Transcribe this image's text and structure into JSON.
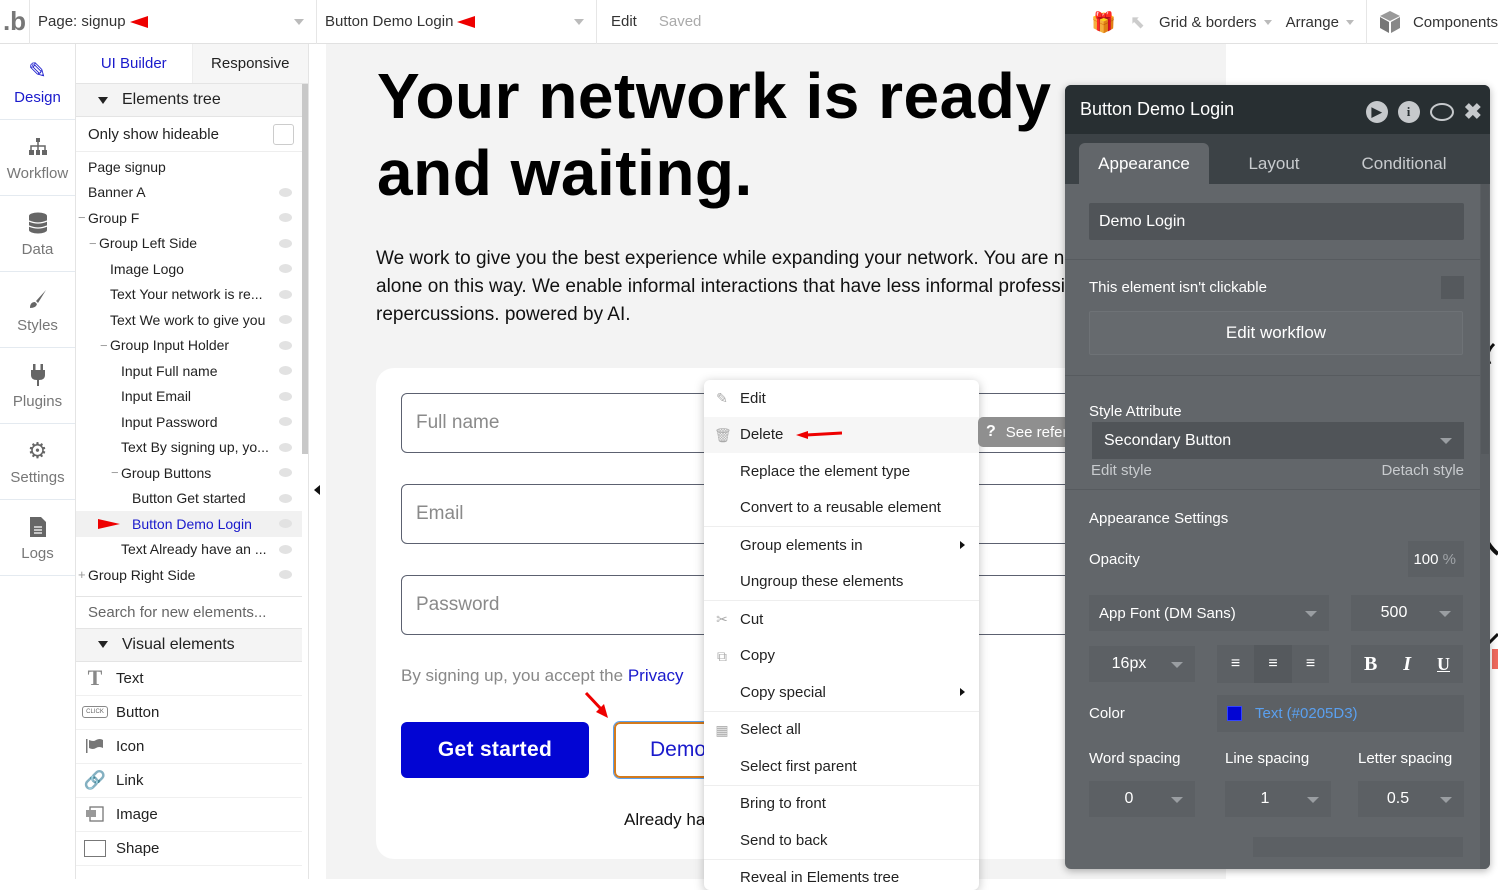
{
  "topbar": {
    "logo": ".b",
    "page_selector": "Page: signup",
    "element_selector": "Button Demo Login",
    "edit": "Edit",
    "saved": "Saved",
    "grid_borders": "Grid & borders",
    "arrange": "Arrange",
    "components": "Components"
  },
  "leftnav": [
    {
      "label": "Design",
      "icon": "design-icon",
      "active": true
    },
    {
      "label": "Workflow",
      "icon": "workflow-icon"
    },
    {
      "label": "Data",
      "icon": "database-icon"
    },
    {
      "label": "Styles",
      "icon": "brush-icon"
    },
    {
      "label": "Plugins",
      "icon": "plug-icon"
    },
    {
      "label": "Settings",
      "icon": "gear-icon"
    },
    {
      "label": "Logs",
      "icon": "document-icon"
    }
  ],
  "panel": {
    "tabs": [
      "UI Builder",
      "Responsive"
    ],
    "elements_tree_title": "Elements tree",
    "only_show_hideable": "Only show hideable",
    "tree": [
      {
        "label": "Page signup",
        "depth": 0,
        "toggle": "",
        "eye": false
      },
      {
        "label": "Banner A",
        "depth": 0,
        "toggle": "",
        "eye": true
      },
      {
        "label": "Group F",
        "depth": 0,
        "toggle": "−",
        "eye": true
      },
      {
        "label": "Group Left Side",
        "depth": 1,
        "toggle": "−",
        "eye": true
      },
      {
        "label": "Image Logo",
        "depth": 2,
        "toggle": "",
        "eye": true
      },
      {
        "label": "Text Your network is re...",
        "depth": 2,
        "toggle": "",
        "eye": true
      },
      {
        "label": "Text We work to give you",
        "depth": 2,
        "toggle": "",
        "eye": true
      },
      {
        "label": "Group Input Holder",
        "depth": 2,
        "toggle": "−",
        "eye": true
      },
      {
        "label": "Input Full name",
        "depth": 3,
        "toggle": "",
        "eye": true
      },
      {
        "label": "Input Email",
        "depth": 3,
        "toggle": "",
        "eye": true
      },
      {
        "label": "Input Password",
        "depth": 3,
        "toggle": "",
        "eye": true
      },
      {
        "label": "Text By signing up, yo...",
        "depth": 3,
        "toggle": "",
        "eye": true
      },
      {
        "label": "Group Buttons",
        "depth": 3,
        "toggle": "−",
        "eye": true
      },
      {
        "label": "Button Get started",
        "depth": 4,
        "toggle": "",
        "eye": true
      },
      {
        "label": "Button Demo Login",
        "depth": 4,
        "toggle": "",
        "eye": true,
        "selected": true
      },
      {
        "label": "Text Already have an ...",
        "depth": 3,
        "toggle": "",
        "eye": true
      },
      {
        "label": "Group Right Side",
        "depth": 0,
        "toggle": "+",
        "eye": true
      }
    ],
    "search_placeholder": "Search for new elements...",
    "visual_elements_title": "Visual elements",
    "visual_elements": [
      {
        "label": "Text",
        "icon": "text-icon"
      },
      {
        "label": "Button",
        "icon": "button-icon",
        "badge": "CLICK"
      },
      {
        "label": "Icon",
        "icon": "flag-icon"
      },
      {
        "label": "Link",
        "icon": "link-icon"
      },
      {
        "label": "Image",
        "icon": "image-icon"
      },
      {
        "label": "Shape",
        "icon": "shape-icon"
      }
    ]
  },
  "canvas": {
    "headline_line1": "Your network is ready",
    "headline_line2": "and waiting.",
    "para_line1": "We work to give you the best experience while expanding your network. You are not",
    "para_line2": "alone on this way. We enable informal interactions that have less informal professional",
    "para_line3": "repercussions. powered by AI.",
    "inputs": [
      {
        "placeholder": "Full name"
      },
      {
        "placeholder": "Email"
      },
      {
        "placeholder": "Password"
      }
    ],
    "terms_prefix": "By signing up, you accept the ",
    "terms_link": "Privacy",
    "btn_get_started": "Get started",
    "btn_demo": "Demo Login",
    "already": "Already have an account?"
  },
  "context_menu": {
    "items": [
      {
        "label": "Edit",
        "icon": "edit-icon",
        "group": 1
      },
      {
        "label": "Delete",
        "icon": "trash-icon",
        "group": 1,
        "hover": true
      },
      {
        "label": "Replace the element type",
        "group": 1
      },
      {
        "label": "Convert to a reusable element",
        "group": 1
      },
      {
        "label": "Group elements in",
        "group": 2,
        "submenu": true
      },
      {
        "label": "Ungroup these elements",
        "group": 2
      },
      {
        "label": "Cut",
        "icon": "scissors-icon",
        "group": 3
      },
      {
        "label": "Copy",
        "icon": "copy-icon",
        "group": 3
      },
      {
        "label": "Copy special",
        "group": 3,
        "submenu": true
      },
      {
        "label": "Select all",
        "icon": "grid-icon",
        "group": 4
      },
      {
        "label": "Select first parent",
        "group": 4
      },
      {
        "label": "Bring to front",
        "group": 5
      },
      {
        "label": "Send to back",
        "group": 5
      },
      {
        "label": "Reveal in Elements tree",
        "group": 6
      }
    ],
    "see_reference": "See reference →"
  },
  "inspector": {
    "title": "Button Demo Login",
    "tabs": [
      "Appearance",
      "Layout",
      "Conditional"
    ],
    "text_value": "Demo Login",
    "not_clickable_label": "This element isn't clickable",
    "edit_workflow": "Edit workflow",
    "style_attribute_label": "Style Attribute",
    "style_value": "Secondary Button",
    "edit_style": "Edit style",
    "detach_style": "Detach style",
    "appearance_settings": "Appearance Settings",
    "opacity_label": "Opacity",
    "opacity_value": "100",
    "opacity_unit": "%",
    "font": "App Font (DM Sans)",
    "font_weight": "500",
    "font_size": "16px",
    "align_active": "center",
    "color_label": "Color",
    "color_value": "Text (#0205D3)",
    "color_swatch": "#0205D3",
    "word_spacing_label": "Word spacing",
    "line_spacing_label": "Line spacing",
    "letter_spacing_label": "Letter spacing",
    "word_spacing": "0",
    "line_spacing": "1",
    "letter_spacing": "0.5"
  },
  "colors": {
    "accent": "#1a1acc",
    "primary_button": "#0205d3",
    "inspector_bg": "#62666a",
    "inspector_head": "#282f32"
  }
}
